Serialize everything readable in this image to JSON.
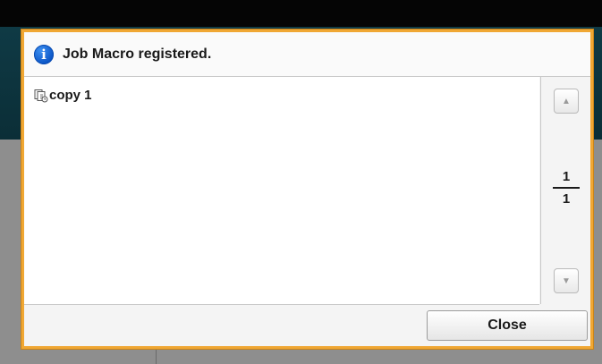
{
  "dialog": {
    "title": "Job Macro registered.",
    "info_icon": "info-icon"
  },
  "list": {
    "items": [
      {
        "icon": "copy-macro-icon",
        "label": "copy 1"
      }
    ]
  },
  "pager": {
    "current": "1",
    "total": "1",
    "up_icon": "▲",
    "down_icon": "▼"
  },
  "footer": {
    "close_label": "Close"
  },
  "colors": {
    "dialog_border": "#f0a733",
    "info_icon": "#1565d8",
    "header_bg": "#0f3a45"
  }
}
